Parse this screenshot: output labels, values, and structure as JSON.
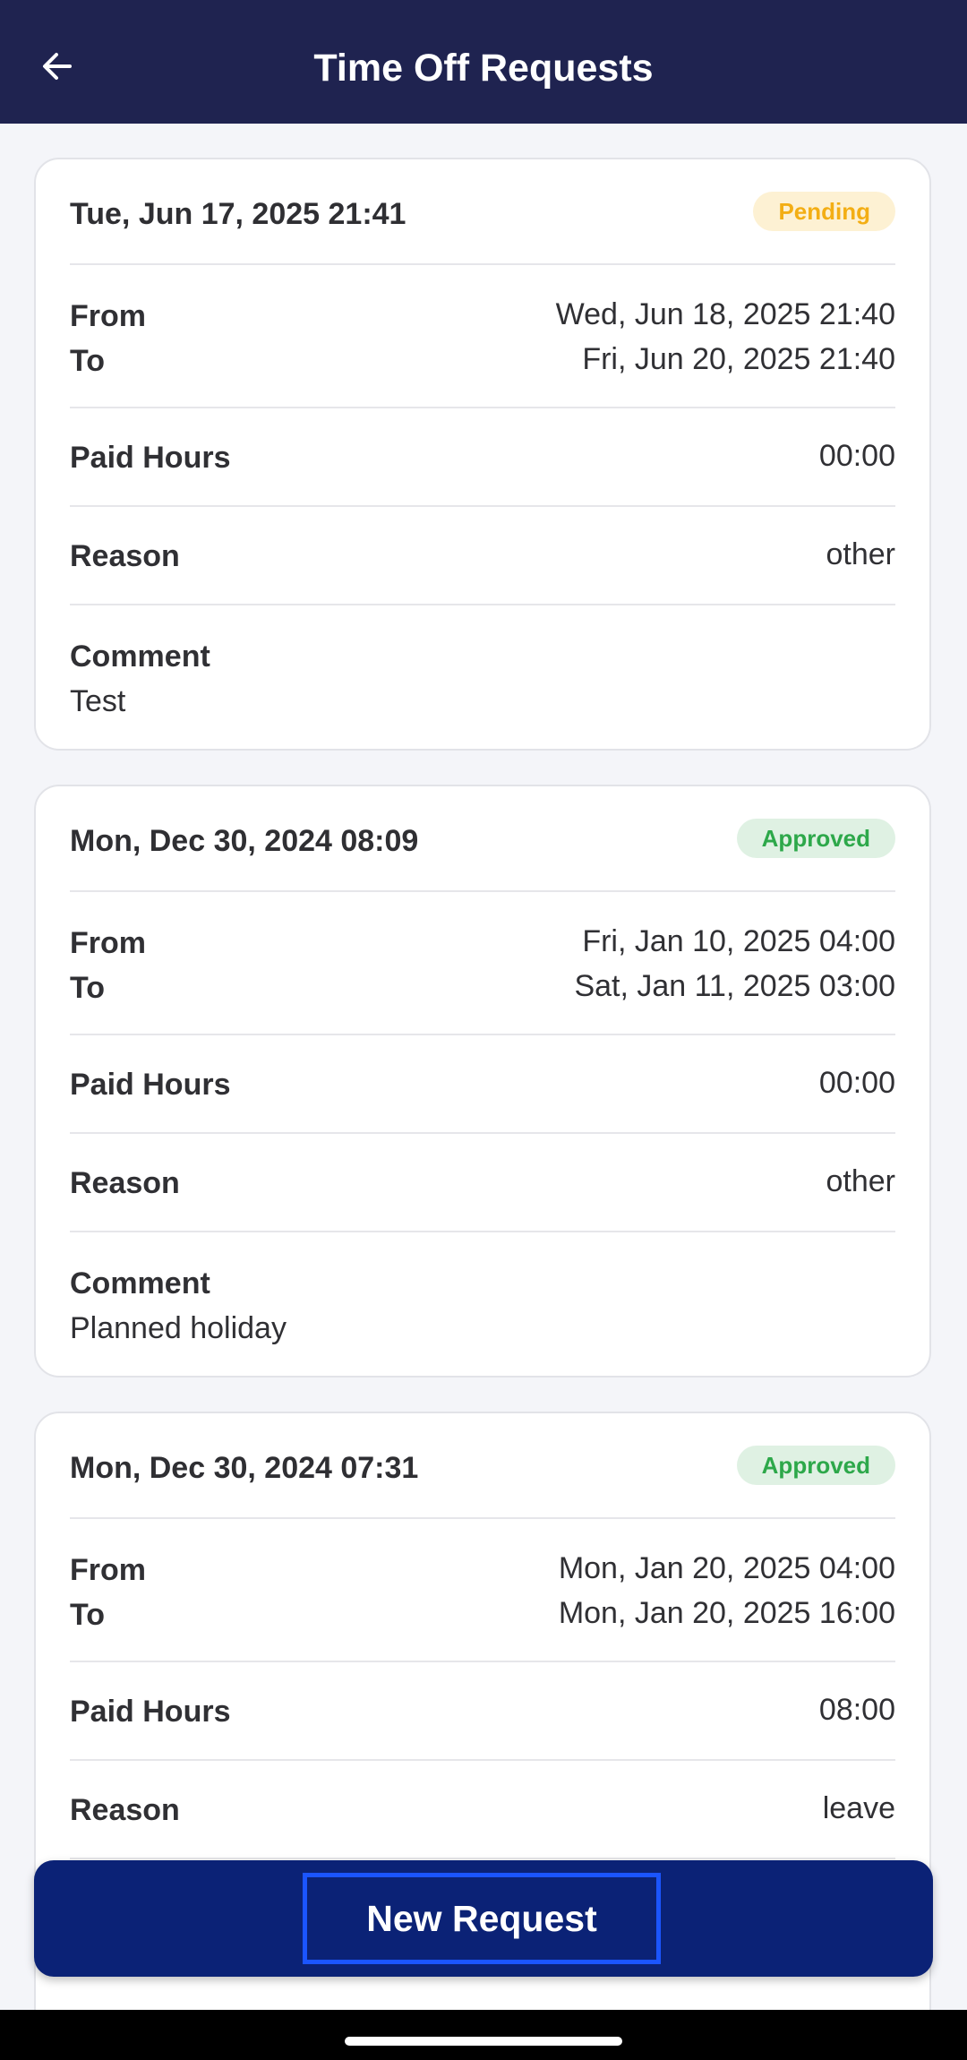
{
  "header": {
    "title": "Time Off Requests",
    "back_icon": "arrow-left-icon"
  },
  "requests": [
    {
      "created": "Tue, Jun 17, 2025 21:41",
      "status": "Pending",
      "from_label": "From",
      "from_value": "Wed, Jun 18, 2025 21:40",
      "to_label": "To",
      "to_value": "Fri, Jun 20, 2025 21:40",
      "paid_hours_label": "Paid Hours",
      "paid_hours_value": "00:00",
      "reason_label": "Reason",
      "reason_value": "other",
      "comment_label": "Comment",
      "comment_value": "Test"
    },
    {
      "created": "Mon, Dec 30, 2024 08:09",
      "status": "Approved",
      "from_label": "From",
      "from_value": "Fri, Jan 10, 2025 04:00",
      "to_label": "To",
      "to_value": "Sat, Jan 11, 2025 03:00",
      "paid_hours_label": "Paid Hours",
      "paid_hours_value": "00:00",
      "reason_label": "Reason",
      "reason_value": "other",
      "comment_label": "Comment",
      "comment_value": "Planned holiday"
    },
    {
      "created": "Mon, Dec 30, 2024 07:31",
      "status": "Approved",
      "from_label": "From",
      "from_value": "Mon, Jan 20, 2025 04:00",
      "to_label": "To",
      "to_value": "Mon, Jan 20, 2025 16:00",
      "paid_hours_label": "Paid Hours",
      "paid_hours_value": "08:00",
      "reason_label": "Reason",
      "reason_value": "leave"
    }
  ],
  "actions": {
    "new_request_label": "New Request"
  },
  "colors": {
    "header_bg": "#1f2350",
    "button_bar_bg": "#0b2276",
    "button_focus_border": "#1b55ff",
    "pending_text": "#f3ae14",
    "pending_bg": "#fdf1d3",
    "approved_text": "#2da84a",
    "approved_bg": "#dff1e3"
  }
}
